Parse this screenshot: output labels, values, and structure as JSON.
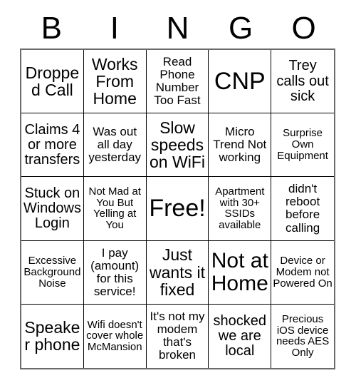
{
  "card": {
    "title": "BINGO",
    "header_letters": [
      "B",
      "I",
      "N",
      "G",
      "O"
    ],
    "grid_size": "5x5",
    "free_space": "Free!",
    "colors": {
      "background": "#ffffff",
      "text": "#000000",
      "inner_border": "#000000",
      "outer_border": "#6b6b6b"
    },
    "rows": [
      [
        {
          "text": "Dropped Call",
          "size": "lg"
        },
        {
          "text": "Works From Home",
          "size": "lg"
        },
        {
          "text": "Read Phone Number Too Fast",
          "size": "sm"
        },
        {
          "text": "CNP",
          "size": "xxl"
        },
        {
          "text": "Trey calls out sick",
          "size": "md"
        }
      ],
      [
        {
          "text": "Claims 4 or more transfers",
          "size": "md"
        },
        {
          "text": "Was out all day yesterday",
          "size": "sm"
        },
        {
          "text": "Slow speeds on WiFi",
          "size": "lg"
        },
        {
          "text": "Micro Trend Not working",
          "size": "sm"
        },
        {
          "text": "Surprise Own Equipment",
          "size": "xs"
        }
      ],
      [
        {
          "text": "Stuck on Windows Login",
          "size": "md"
        },
        {
          "text": "Not Mad at You But Yelling at You",
          "size": "xs"
        },
        {
          "text": "Free!",
          "size": "xxl"
        },
        {
          "text": "Apartment with 30+ SSIDs available",
          "size": "xs"
        },
        {
          "text": "didn't reboot before calling",
          "size": "sm"
        }
      ],
      [
        {
          "text": "Excessive Background Noise",
          "size": "xs"
        },
        {
          "text": "I pay (amount) for this service!",
          "size": "sm"
        },
        {
          "text": "Just wants it fixed",
          "size": "lg"
        },
        {
          "text": "Not at Home",
          "size": "xl"
        },
        {
          "text": "Device or Modem not Powered On",
          "size": "xs"
        }
      ],
      [
        {
          "text": "Speaker phone",
          "size": "lg"
        },
        {
          "text": "Wifi doesn't cover whole McMansion",
          "size": "xs"
        },
        {
          "text": "It's not my modem that's broken",
          "size": "sm"
        },
        {
          "text": "shocked we are local",
          "size": "md"
        },
        {
          "text": "Precious iOS device needs AES Only",
          "size": "xs"
        }
      ]
    ]
  }
}
